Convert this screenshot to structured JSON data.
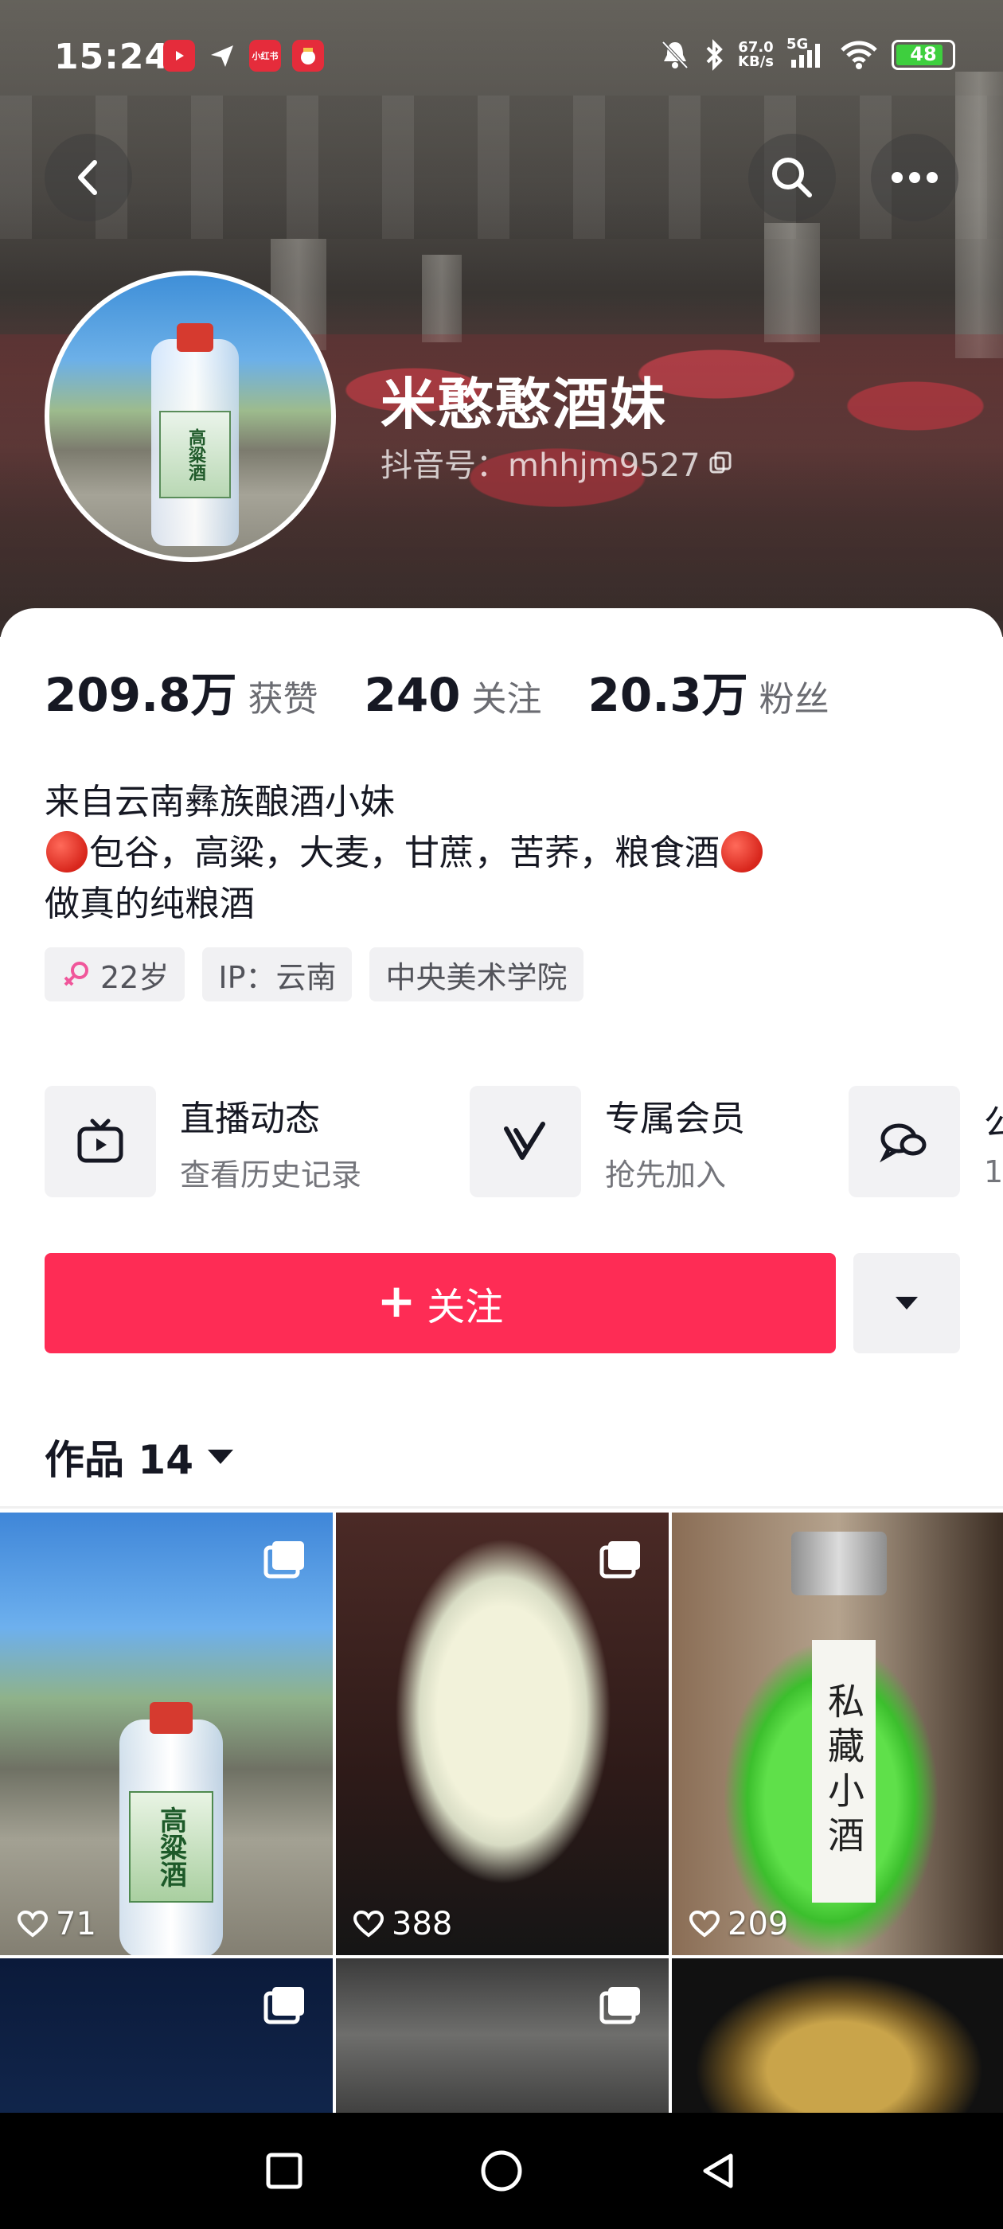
{
  "status_bar": {
    "time": "15:24",
    "notif_labels": [
      "小红书"
    ],
    "net_speed_value": "67.0",
    "net_speed_unit": "KB/s",
    "network": "5G",
    "battery": "48"
  },
  "header": {
    "back_icon": "back-arrow-icon",
    "search_icon": "search-icon",
    "more_icon": "more-icon"
  },
  "profile": {
    "name": "米憨憨酒妹",
    "douyin_id": "抖音号：mhhjm9527",
    "avatar_label": "高粱酒"
  },
  "stats": [
    {
      "value": "209.8万",
      "label": "获赞"
    },
    {
      "value": "240",
      "label": "关注"
    },
    {
      "value": "20.3万",
      "label": "粉丝"
    }
  ],
  "bio": {
    "line1": "来自云南彝族酿酒小妹",
    "line2": "包谷，高粱，大麦，甘蔗，苦荞，粮食酒",
    "line3": "做真的纯粮酒"
  },
  "tags": {
    "age": "22岁",
    "ip": "IP：云南",
    "school": "中央美术学院"
  },
  "features": [
    {
      "title": "直播动态",
      "subtitle": "查看历史记录",
      "icon": "tv-icon"
    },
    {
      "title": "专属会员",
      "subtitle": "抢先加入",
      "icon": "vip-v-icon"
    },
    {
      "title": "公",
      "subtitle": "1",
      "icon": "chat-group-icon"
    }
  ],
  "actions": {
    "follow_label": "关注",
    "more_icon": "caret-down-icon"
  },
  "works": {
    "label": "作品",
    "count": "14"
  },
  "grid": [
    {
      "likes": "71",
      "multi": true,
      "label": "高粱酒"
    },
    {
      "likes": "388",
      "multi": true
    },
    {
      "likes": "209",
      "multi": false,
      "label": "私藏小酒"
    },
    {
      "multi": true
    },
    {
      "multi": true
    },
    {
      "multi": false
    }
  ],
  "colors": {
    "accent": "#fe2c55",
    "text_primary": "#161823",
    "text_secondary": "#6b6c72"
  }
}
